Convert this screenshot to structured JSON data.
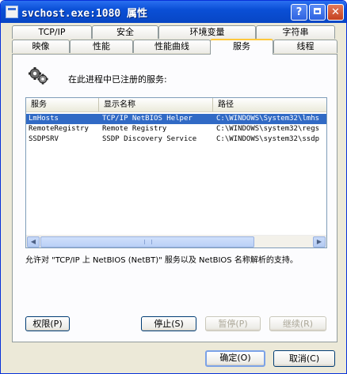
{
  "window": {
    "title": "svchost.exe:1080 属性",
    "help_label": "?",
    "maximize_label": "",
    "close_label": "✕"
  },
  "tabs": {
    "row1": [
      "TCP/IP",
      "安全",
      "环境变量",
      "字符串"
    ],
    "row2": [
      "映像",
      "性能",
      "性能曲线",
      "服务",
      "线程"
    ],
    "active": "服务"
  },
  "heading": "在此进程中已注册的服务:",
  "list": {
    "columns": [
      "服务",
      "显示名称",
      "路径"
    ],
    "rows": [
      {
        "service": "LmHosts",
        "display": "TCP/IP NetBIOS Helper",
        "path": "C:\\WINDOWS\\System32\\lmhs",
        "selected": true
      },
      {
        "service": "RemoteRegistry",
        "display": "Remote Registry",
        "path": "C:\\WINDOWS\\system32\\regs",
        "selected": false
      },
      {
        "service": "SSDPSRV",
        "display": "SSDP Discovery Service",
        "path": "C:\\WINDOWS\\system32\\ssdp",
        "selected": false
      }
    ],
    "scroll_left": "◀",
    "scroll_right": "▶"
  },
  "description": "允许对 \"TCP/IP 上 NetBIOS (NetBT)\" 服务以及 NetBIOS 名称解析的支持。",
  "buttons": {
    "permissions": "权限(P)",
    "stop": "停止(S)",
    "pause": "暂停(P)",
    "resume": "继续(R)",
    "ok": "确定(O)",
    "cancel": "取消(C)"
  },
  "colors": {
    "titlebar": "#0a4fd6",
    "selection": "#316ac5",
    "active_tab_accent": "#ffc83c"
  }
}
